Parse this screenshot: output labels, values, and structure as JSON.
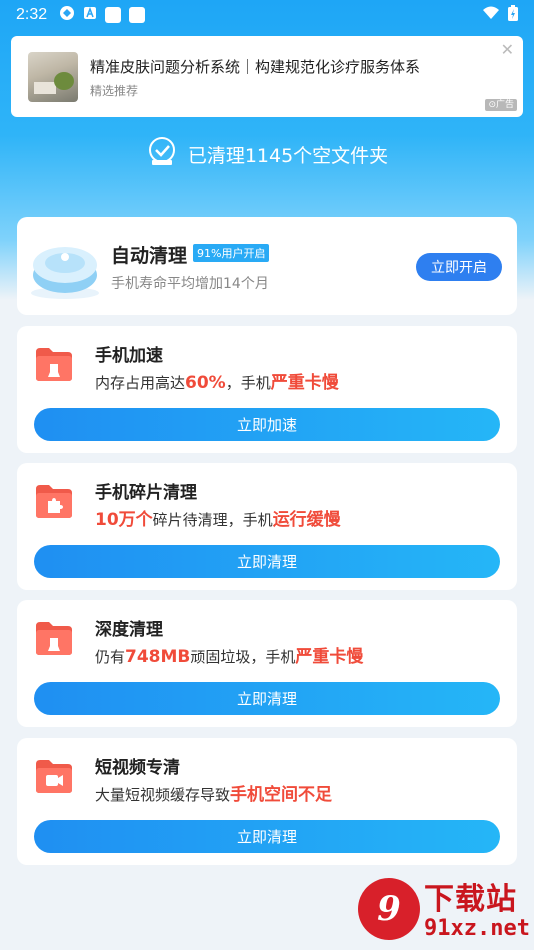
{
  "status_bar": {
    "time": "2:32",
    "icons": [
      "sync-icon",
      "a-icon",
      "app-square-icon",
      "app-square-icon",
      "wifi-icon",
      "battery-charging-icon"
    ]
  },
  "ad": {
    "title": "精准皮肤问题分析系统｜构建规范化诊疗服务体系",
    "subtitle": "精选推荐",
    "close": "✕",
    "badge": "⊙广告"
  },
  "cleaned_banner": {
    "text": "已清理1145个空文件夹"
  },
  "auto_clean": {
    "title": "自动清理",
    "badge": "91%用户开启",
    "subtitle": "手机寿命平均增加14个月",
    "button": "立即开启"
  },
  "cards": [
    {
      "title": "手机加速",
      "desc_before": "内存占用高达",
      "desc_hl1": "60%",
      "desc_mid": "，手机",
      "desc_hl2": "严重卡慢",
      "button": "立即加速"
    },
    {
      "title": "手机碎片清理",
      "desc_before": "",
      "desc_hl1": "10万个",
      "desc_mid": "碎片待清理，手机",
      "desc_hl2": "运行缓慢",
      "button": "立即清理"
    },
    {
      "title": "深度清理",
      "desc_before": "仍有",
      "desc_hl1": "748MB",
      "desc_mid": "顽固垃圾，手机",
      "desc_hl2": "严重卡慢",
      "button": "立即清理"
    },
    {
      "title": "短视频专清",
      "desc_before": "大量短视频缓存导致",
      "desc_hl1": "",
      "desc_mid": "",
      "desc_hl2": "手机空间不足",
      "button": "立即清理"
    }
  ],
  "watermark": {
    "logo": "9",
    "line1": "下载站",
    "line2": "91xz.net"
  },
  "colors": {
    "accent_blue": "#2e7ff0",
    "highlight_red": "#f04b3a",
    "folder_red": "#f05a4a"
  }
}
